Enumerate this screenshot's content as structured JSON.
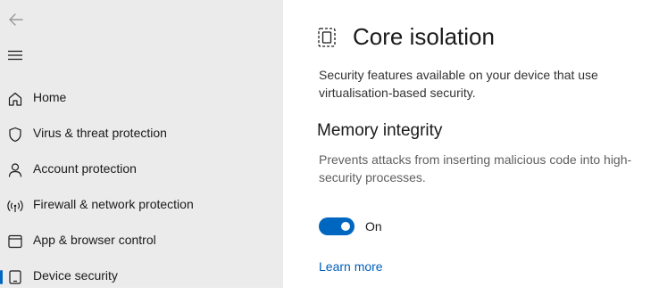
{
  "sidebar": {
    "items": [
      {
        "label": "Home",
        "icon": "home-icon"
      },
      {
        "label": "Virus & threat protection",
        "icon": "shield-icon"
      },
      {
        "label": "Account protection",
        "icon": "person-icon"
      },
      {
        "label": "Firewall & network protection",
        "icon": "wireless-icon"
      },
      {
        "label": "App & browser control",
        "icon": "app-window-icon"
      },
      {
        "label": "Device security",
        "icon": "device-icon",
        "selected": true
      }
    ]
  },
  "main": {
    "title": "Core isolation",
    "title_icon": "core-isolation-chip-icon",
    "description": "Security features available on your device that use virtualisation-based security.",
    "memory_integrity": {
      "title": "Memory integrity",
      "description": "Prevents attacks from inserting malicious code into high-security processes.",
      "toggle_on": true,
      "toggle_label": "On"
    },
    "learn_more": "Learn more"
  },
  "colors": {
    "accent": "#0067c0",
    "link": "#005fb8",
    "sidebar_bg": "#ebebeb"
  }
}
